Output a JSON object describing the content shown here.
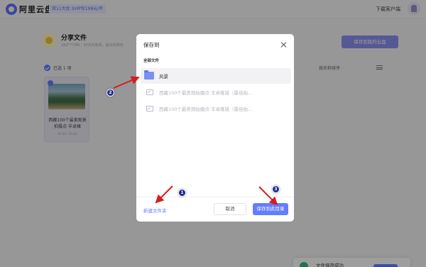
{
  "app": {
    "brand": "阿里云盘",
    "promo": "双11大促 SVIP仅198元/年",
    "download_client": "下载客户端"
  },
  "share": {
    "title": "分享文件",
    "meta": "182***280 · 30天内有效，提示快保存",
    "save_my_button": "保存到我的云盘",
    "selected_text": "已选 1 项",
    "sort_label": "按名称排序",
    "card_name": "西藏100个最美观景拍摄点·羊卓雍",
    "card_date": "05-01 15:44"
  },
  "toast": {
    "text": "文件保存成功"
  },
  "dialog": {
    "title": "保存到",
    "section_label": "全部文件",
    "rows": [
      {
        "label": "风景",
        "type": "folder",
        "selected": true
      },
      {
        "label": "西藏100个最美观拍摄点·羊卓雍错（最佳拍...",
        "type": "file",
        "selected": false
      },
      {
        "label": "西藏100个最美观拍摄点·羊卓雍错（最佳拍...",
        "type": "file",
        "selected": false
      }
    ],
    "new_folder": "新建文件夹",
    "cancel": "取消",
    "confirm": "保存到此目录"
  },
  "annotations": {
    "badge_1": "1",
    "badge_2": "2",
    "badge_3": "3"
  },
  "colors": {
    "accent": "#637dff",
    "arrow": "#d21f1f",
    "badge": "#1f2a8a"
  }
}
